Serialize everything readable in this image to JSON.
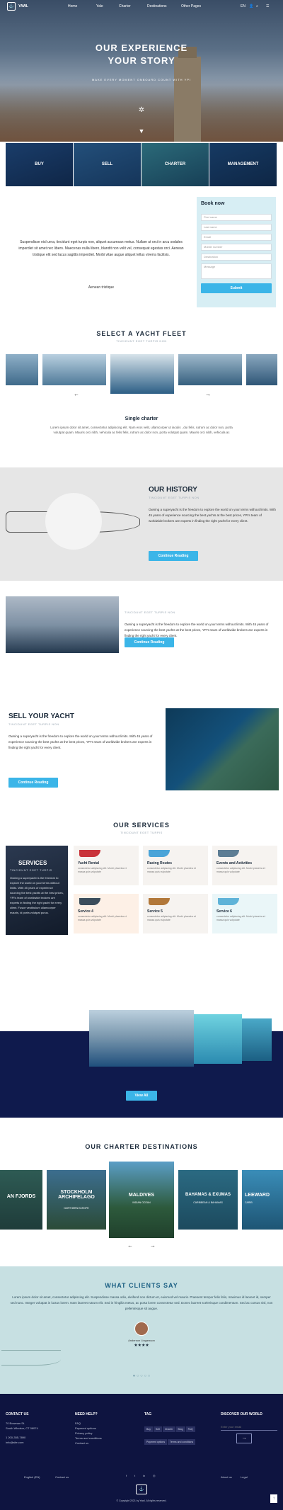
{
  "colors": {
    "accent": "#3bb5e8",
    "navy": "#0f1a4d",
    "footer": "#0e1440",
    "tiffany": "#c7e0e2"
  },
  "header": {
    "brand": "YAWL",
    "nav": [
      "Home",
      "Yale",
      "Charter",
      "Destinations",
      "Other Pages"
    ],
    "lang": "EN",
    "icons": [
      "user-icon",
      "search-icon",
      "menu-icon"
    ]
  },
  "hero": {
    "title_line1": "OUR EXPERIENCE",
    "title_line2": "YOUR STORY",
    "subtitle": "MAKE EVERY MOMENT ONBOARD COUNT WITH YPI"
  },
  "tabs": [
    "BUY",
    "SELL",
    "CHARTER",
    "MANAGEMENT"
  ],
  "intro": {
    "text": "Suspendisse nisl urna, tincidunt eget turpis non, aliquet accumsan metus. Nullam ut orci in arcu sodales imperdiet sit amet nec libero. Maecenas nulla libero, blandit non velit vel, consequat egestas orci. Aenean tristique elit sed lacus sagittis imperdiet. Morbi vitae augue aliquet tellus viverra facilisis.",
    "tail": "Aenean tristique"
  },
  "booking": {
    "title": "Book now",
    "fields": [
      "First name",
      "Last name",
      "Email",
      "Mobile number",
      "Destination",
      "Message"
    ],
    "submit": "Submit"
  },
  "fleet": {
    "title": "SELECT A YACHT FLEET",
    "subtitle": "TINCIDUNT EGET TURPIS NON",
    "item_title": "Single charter",
    "item_desc": "Lorem ipsum dolor sit amet, consectetur adipiscing elit. Nam eros velit, ullamcorper ut iaculis , dui felis, rutrum ac dolor non, porta volutpat quam. Mauris orci nibh, vehicula ac felis felis, rutrum ac dolor non, porta volutpat quam. Mauris orci nibh, vehicula ac"
  },
  "history": {
    "title": "OUR HISTORY",
    "subtitle": "TINCIDUNT EGET TURPIS NON",
    "text": "Owning a superyacht is the freedom to explore the world on your terms without limits. With 45 years of experience sourcing the best yachts at the best prices, YPI's team of worldwide brokers are experts in finding the right yacht for every client.",
    "button": "Continue Reading"
  },
  "block2": {
    "subtitle": "TINCIDUNT EGET TURPIS NON",
    "text": "Owning a superyacht is the freedom to explore the world on your terms without limits. With 45 years of experience sourcing the best yachts at the best prices, YPI's team of worldwide brokers are experts in finding the right yacht for every client.",
    "button": "Continue Reading"
  },
  "sell": {
    "title": "SELL YOUR YACHT",
    "subtitle": "TINCIDUNT EGET TURPIS NON",
    "text": "Owning a superyacht is the freedom to explore the world on your terms without limits. With 45 years of experience sourcing the best yachts at the best prices, YPI's team of worldwide brokers are experts in finding the right yacht for every client.",
    "button": "Continue Reading"
  },
  "services": {
    "title": "OUR SERVICES",
    "subtitle": "TINCIDUNT EGET TURPIS",
    "side_title": "SERVICES",
    "side_sub": "TINCIDUNT EGET TURPIS",
    "side_text": "Owning a superyacht is the freedom to explore the world on your terms without limits. With 45 years of experience sourcing the best yachts at the best prices, YPI's team of worldwide brokers are experts in finding the right yacht for every client. Fusce vestibulum ullamcorper mauris, id porta volutpat purus.",
    "items": [
      {
        "title": "Yacht Rental",
        "desc": "consectetur adipiscing elit. Morbi pharetra et massa quis vulputate"
      },
      {
        "title": "Racing Routes",
        "desc": "consectetur adipiscing elit. Morbi pharetra et massa quis vulputate"
      },
      {
        "title": "Events and Activities",
        "desc": "consectetur adipiscing elit. Morbi pharetra et massa quis vulputate"
      },
      {
        "title": "Service 4",
        "desc": "consectetur adipiscing elit. Morbi pharetra et massa quis vulputate"
      },
      {
        "title": "Service 5",
        "desc": "consectetur adipiscing elit. Morbi pharetra et massa quis vulputate"
      },
      {
        "title": "Service 6",
        "desc": "consectetur adipiscing elit. Morbi pharetra et massa quis vulputate"
      }
    ]
  },
  "gallery": {
    "button": "View All"
  },
  "destinations": {
    "title": "OUR CHARTER DESTINATIONS",
    "items": [
      {
        "name": "AN FJORDS",
        "sub": ""
      },
      {
        "name": "STOCKHOLM ARCHIPELAGO",
        "sub": "NORTHERN EUROPE"
      },
      {
        "name": "MALDIVES",
        "sub": "INDIAN OCEAN"
      },
      {
        "name": "BAHAMAS & EXUMAS",
        "sub": "CARIBBEAN & BAHAMAS"
      },
      {
        "name": "LEEWARD",
        "sub": "CARIB"
      }
    ]
  },
  "testimonials": {
    "title": "WHAT CLIENTS SAY",
    "text": "Lorem ipsum dolor sit amet, consectetur adipiscing elit. Suspendisse massa odio, eleifend non dictum et, euismod vel mauris. Praesent tempor felis felis, maximus id laoreet id, semper sed nunc. Integer volutpat in luctus lorem. Nam laoreet rutrum elit. Sed in fringilla metus, ac porta lorem consectetur sed. Donec laoreet scelerisque condimentum. Sed ac cursus nisl, non pellentesque sit augue.",
    "name": "Anderson Lingarsson",
    "stars": "★★★★"
  },
  "footer": {
    "contact_title": "CONTACT US",
    "address1": "70 Bowman St.",
    "address2": "South Windsor, CT 06074",
    "phone": "1 200-355-7890",
    "email": "info@site.com",
    "help_title": "NEED HELP?",
    "help_links": [
      "FAQ",
      "Payment options",
      "Privacy policy",
      "Terms and conditions",
      "Contact us"
    ],
    "tag_title": "TAG",
    "tags": [
      "Buy",
      "Sell",
      "Charter",
      "Blog",
      "FAQ",
      "Payment options",
      "Terms and conditions"
    ],
    "discover_title": "DISCOVER OUR WORLD",
    "email_placeholder": "Enter your email",
    "lang": "English (EN)",
    "contact_btn": "Contact us",
    "about": "About us",
    "legal": "Legal",
    "copyright": "© Copyright 2021 by Yawl. All rights reserved.",
    "social": [
      "facebook-icon",
      "twitter-icon",
      "linkedin-icon",
      "instagram-icon"
    ]
  }
}
